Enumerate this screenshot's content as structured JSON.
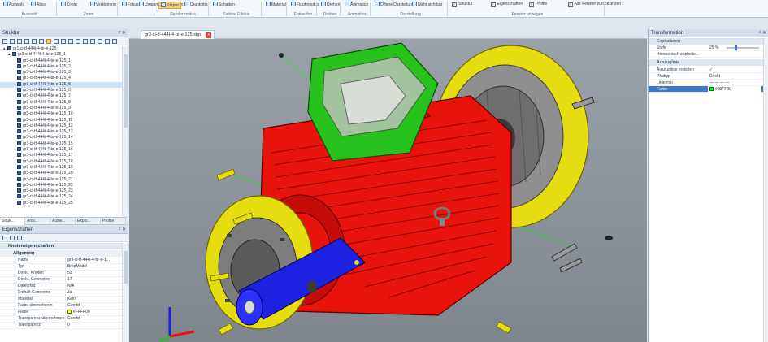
{
  "ribbon": {
    "groups": [
      {
        "label": "Auswahl",
        "buttons": [
          "Auswahl",
          "Alles"
        ]
      },
      {
        "label": "Zoom",
        "buttons": [
          "Zoom",
          "Verkleinern"
        ]
      },
      {
        "label": "",
        "buttons": [
          "Fokus",
          "Umgang verschieben"
        ]
      },
      {
        "label": "Rendermodus",
        "buttons": [
          "Körper",
          "Drahtgitter"
        ]
      },
      {
        "label": "Sektive Effekte",
        "buttons": [
          "Schatten"
        ]
      },
      {
        "label": "",
        "buttons": [
          "Material"
        ]
      },
      {
        "label": "Entwerfen",
        "buttons": [
          "Flughmodus"
        ]
      },
      {
        "label": "Drehen",
        "buttons": [
          "Drehen"
        ]
      },
      {
        "label": "Animation",
        "buttons": [
          "Animation"
        ]
      },
      {
        "label": "Darstellung",
        "buttons": [
          "Offene Darstellung",
          "Nicht sichtbar"
        ]
      },
      {
        "label": "Fenster anzeigen",
        "buttons": [
          "Struktur",
          "Eigenschaften",
          "Profile",
          "Alle Fenster zurücksetzen"
        ]
      }
    ]
  },
  "structure": {
    "title": "Struktur",
    "items": [
      {
        "label": "gr1-ci-tf-444t-4-br-e-125",
        "level": 0,
        "exp": "▴"
      },
      {
        "label": "gr3-ci-tf-444t-4-br-e-125_1",
        "level": 1,
        "exp": "▴"
      },
      {
        "label": "gr3-ci-tf-444t-4-br-e-125_1",
        "level": 2,
        "exp": ""
      },
      {
        "label": "gr3-ci-tf-444t-4-br-e-125_2",
        "level": 2,
        "exp": ""
      },
      {
        "label": "gr3-ci-tf-444t-4-br-e-125_3",
        "level": 2,
        "exp": ""
      },
      {
        "label": "gr3-ci-tf-444t-4-br-e-125_4",
        "level": 2,
        "exp": ""
      },
      {
        "label": "gr3-ci-tf-444t-4-br-e-125_5",
        "level": 2,
        "exp": ""
      },
      {
        "label": "gr3-ci-tf-444t-4-br-e-125_6",
        "level": 2,
        "exp": ""
      },
      {
        "label": "gr3-ci-tf-444t-4-br-e-125_7",
        "level": 2,
        "exp": ""
      },
      {
        "label": "gr3-ci-tf-444t-4-br-e-125_8",
        "level": 2,
        "exp": ""
      },
      {
        "label": "gr3-ci-tf-444t-4-br-e-125_9",
        "level": 2,
        "exp": ""
      },
      {
        "label": "gr3-ci-tf-444t-4-br-e-125_10",
        "level": 2,
        "exp": ""
      },
      {
        "label": "gr3-ci-tf-444t-4-br-e-125_11",
        "level": 2,
        "exp": ""
      },
      {
        "label": "gr3-ci-tf-444t-4-br-e-125_12",
        "level": 2,
        "exp": ""
      },
      {
        "label": "gr3-ci-tf-444t-4-br-e-125_13",
        "level": 2,
        "exp": ""
      },
      {
        "label": "gr3-ci-tf-444t-4-br-e-125_14",
        "level": 2,
        "exp": ""
      },
      {
        "label": "gr3-ci-tf-444t-4-br-e-125_15",
        "level": 2,
        "exp": ""
      },
      {
        "label": "gr3-ci-tf-444t-4-br-e-125_16",
        "level": 2,
        "exp": ""
      },
      {
        "label": "gr3-ci-tf-444t-4-br-e-125_17",
        "level": 2,
        "exp": ""
      },
      {
        "label": "gr3-ci-tf-444t-4-br-e-125_18",
        "level": 2,
        "exp": ""
      },
      {
        "label": "gr3-ci-tf-444t-4-br-e-125_19",
        "level": 2,
        "exp": ""
      },
      {
        "label": "gr3-ci-tf-444t-4-br-e-125_20",
        "level": 2,
        "exp": ""
      },
      {
        "label": "gr3-ci-tf-444t-4-br-e-125_21",
        "level": 2,
        "exp": ""
      },
      {
        "label": "gr3-ci-tf-444t-4-br-e-125_22",
        "level": 2,
        "exp": ""
      },
      {
        "label": "gr3-ci-tf-444t-4-br-e-125_23",
        "level": 2,
        "exp": ""
      },
      {
        "label": "gr3-ci-tf-444t-4-br-e-125_24",
        "level": 2,
        "exp": ""
      },
      {
        "label": "gr3-ci-tf-444t-4-br-e-125_25",
        "level": 2,
        "exp": ""
      }
    ],
    "selected_index": 6
  },
  "bottom_tabs": [
    "Struk...",
    "Ansi...",
    "Ausw...",
    "Explo...",
    "Profile"
  ],
  "properties": {
    "title": "Eigenschaften",
    "section_main": "Knoteneigenschaften",
    "section_sub": "Allgemein",
    "rows": [
      {
        "key": "Name",
        "value": "gr3-ci-tf-444t-4-br-e-1..."
      },
      {
        "key": "Typ",
        "value": "BrepModel"
      },
      {
        "key": "Direkt. Knoten",
        "value": "53"
      },
      {
        "key": "Direkt. Geometrie",
        "value": "17"
      },
      {
        "key": "Dateipfad",
        "value": "N/A"
      },
      {
        "key": "Enthält Geometrie",
        "value": "Ja"
      },
      {
        "key": "Material",
        "value": "Kein"
      },
      {
        "key": "Farbe übernehmen",
        "value": "Geerbt"
      },
      {
        "key": "Farbe",
        "value": "#FFFF00"
      },
      {
        "key": "Transparenz übernehmen",
        "value": "Geerbt"
      },
      {
        "key": "Transparenz",
        "value": "0"
      }
    ]
  },
  "document": {
    "tab_label": "gr3-ci-tf-444t-4-br-e-125.shp",
    "close_glyph": "x"
  },
  "transform": {
    "title": "Transformation",
    "section_explode": "Explodieren",
    "explode_rows": [
      {
        "key": "Stufe",
        "value": "25 %"
      },
      {
        "key": "Hierarchisch explodie...",
        "value": ""
      }
    ],
    "section_lines": "Auszuglinie",
    "line_rows": [
      {
        "key": "Auszuglinie erstellen",
        "value": "✓"
      },
      {
        "key": "Pfadtyp",
        "value": "Direkt"
      },
      {
        "key": "Linientyp",
        "value": "— — — —"
      },
      {
        "key": "Farbe",
        "value": "#00FF00"
      }
    ]
  },
  "colors": {
    "accent": "#3b79c9",
    "part_red": "#e8130b",
    "part_yellow": "#f0ea12",
    "part_green": "#27c21b",
    "part_blue": "#1c22e0",
    "line_green": "#00FF00",
    "prop_yellow": "#FFFF00"
  }
}
